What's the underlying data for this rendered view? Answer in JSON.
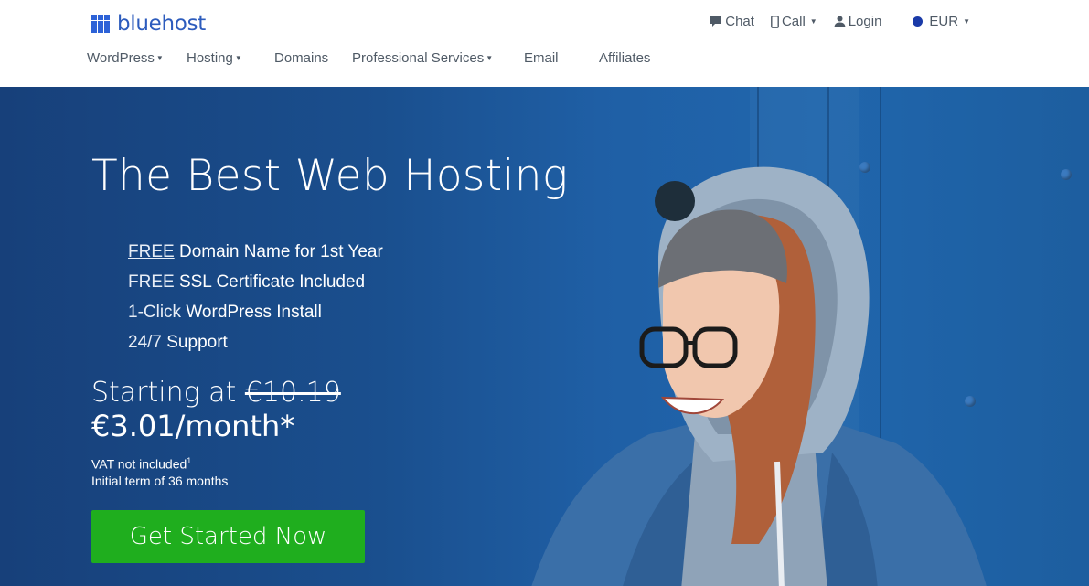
{
  "brand": {
    "name": "bluehost",
    "color": "#2d62d7"
  },
  "top_links": [
    {
      "label": "Chat",
      "icon": "chat-icon"
    },
    {
      "label": "Call",
      "icon": "phone-icon",
      "dropdown": true
    },
    {
      "label": "Login",
      "icon": "user-icon"
    },
    {
      "label": "EUR",
      "icon": "currency-flag-icon",
      "dropdown": true
    }
  ],
  "nav": [
    {
      "label": "WordPress",
      "dropdown": true
    },
    {
      "label": "Hosting",
      "dropdown": true
    },
    {
      "label": "Domains",
      "dropdown": false
    },
    {
      "label": "Professional Services",
      "dropdown": true
    },
    {
      "label": "Email",
      "dropdown": false
    },
    {
      "label": "Affiliates",
      "dropdown": false
    }
  ],
  "hero": {
    "title": "The Best Web Hosting",
    "features": [
      {
        "light": "FREE",
        "bold": " Domain Name for 1st Year",
        "underline": true
      },
      {
        "light": "FREE",
        "bold": " SSL Certificate Included",
        "underline": false
      },
      {
        "light": "1-Click",
        "bold": " WordPress Install",
        "underline": false
      },
      {
        "light": "24/7",
        "bold": " Support",
        "underline": false
      }
    ],
    "price_prefix": "Starting at ",
    "price_old": "€10.19",
    "price_new": "€3.01/month*",
    "vat_note": "VAT not included",
    "vat_sup": "1",
    "term_note": "Initial term of 36 months",
    "cta_label": "Get Started Now",
    "cta_color": "#1fae1e"
  }
}
